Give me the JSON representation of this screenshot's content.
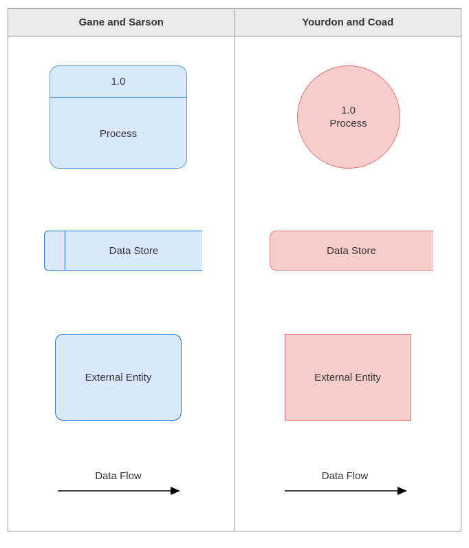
{
  "headers": {
    "left": "Gane and Sarson",
    "right": "Yourdon and Coad"
  },
  "gs": {
    "process_id": "1.0",
    "process_label": "Process",
    "datastore_label": "Data Store",
    "entity_label": "External Entity",
    "dataflow_label": "Data Flow"
  },
  "yc": {
    "process_id": "1.0",
    "process_label": "Process",
    "datastore_label": "Data Store",
    "entity_label": "External Entity",
    "dataflow_label": "Data Flow"
  }
}
